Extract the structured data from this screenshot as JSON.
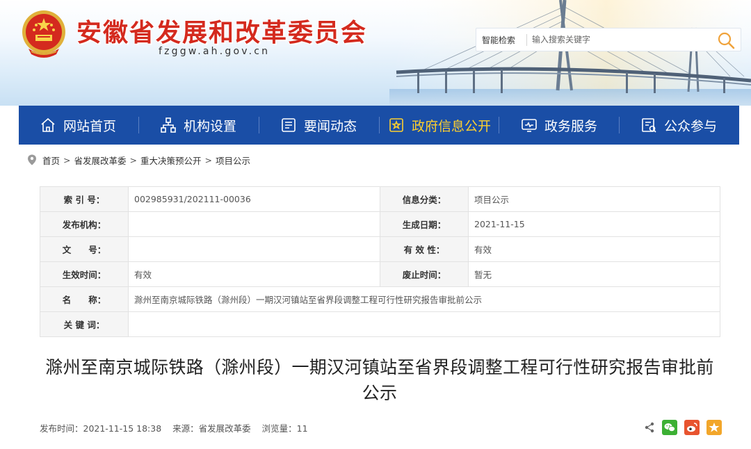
{
  "header": {
    "title": "安徽省发展和改革委员会",
    "domain": "fzggw.ah.gov.cn",
    "search": {
      "label": "智能检索",
      "placeholder": "输入搜索关键字"
    }
  },
  "nav": {
    "items": [
      {
        "label": "网站首页",
        "icon": "home-icon"
      },
      {
        "label": "机构设置",
        "icon": "org-chart-icon"
      },
      {
        "label": "要闻动态",
        "icon": "news-icon"
      },
      {
        "label": "政府信息公开",
        "icon": "gov-info-icon",
        "active": true
      },
      {
        "label": "政务服务",
        "icon": "service-screen-icon"
      },
      {
        "label": "公众参与",
        "icon": "public-participation-icon"
      }
    ],
    "active_color": "#ffd02e",
    "bg_color": "#1a4ea6"
  },
  "breadcrumb": [
    "首页",
    "省发展改革委",
    "重大决策预公开",
    "项目公示"
  ],
  "info": {
    "index_label": "索 引 号：",
    "index_value": "002985931/202111-00036",
    "category_label": "信息分类：",
    "category_value": "项目公示",
    "publisher_label": "发布机构：",
    "publisher_value": "",
    "date_label": "生成日期：",
    "date_value": "2021-11-15",
    "docno_label": "文　　号：",
    "docno_value": "",
    "validity_label": "有 效 性：",
    "validity_value": "有效",
    "effective_label": "生效时间：",
    "effective_value": "有效",
    "repeal_label": "废止时间：",
    "repeal_value": "暂无",
    "name_label": "名　　称：",
    "name_value": "滁州至南京城际铁路（滁州段）一期汉河镇站至省界段调整工程可行性研究报告审批前公示",
    "keywords_label": "关 键 词：",
    "keywords_value": ""
  },
  "article": {
    "title": "滁州至南京城际铁路（滁州段）一期汉河镇站至省界段调整工程可行性研究报告审批前公示",
    "publish_time": "发布时间：2021-11-15 18:38",
    "source": "来源：省发展改革委",
    "views": "浏览量：11"
  },
  "share": {
    "icons": [
      "share-icon",
      "wechat-icon",
      "weibo-icon",
      "favorite-star-icon"
    ],
    "colors": {
      "wechat": "#3cb034",
      "weibo": "#e8542f",
      "favorite": "#f2a62a"
    }
  }
}
